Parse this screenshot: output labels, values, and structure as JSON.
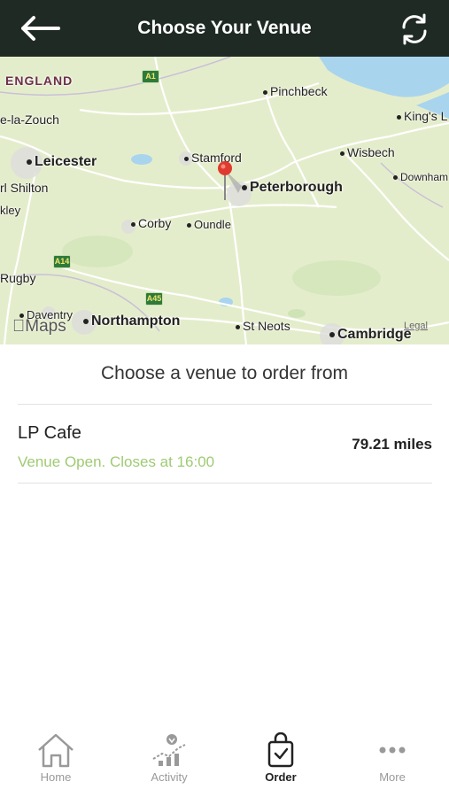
{
  "header": {
    "title": "Choose Your Venue",
    "back_icon": "back-arrow-icon",
    "refresh_icon": "refresh-icon"
  },
  "map": {
    "region_label": "ENGLAND",
    "places": {
      "pinchbeck": "Pinchbeck",
      "kings_lynn": "King's L",
      "ashby": "e-la-Zouch",
      "leicester": "Leicester",
      "stamford": "Stamford",
      "wisbech": "Wisbech",
      "downham": "Downham",
      "hinckley_shilton": "rl Shilton",
      "peterborough": "Peterborough",
      "kley": "kley",
      "corby": "Corby",
      "oundle": "Oundle",
      "rugby": "Rugby",
      "daventry": "Daventry",
      "northampton": "Northampton",
      "st_neots": "St Neots",
      "cambridge": "Cambridge"
    },
    "road_badges": [
      "A1",
      "A14",
      "A45"
    ],
    "provider_label": "Maps",
    "legal_label": "Legal",
    "colors": {
      "land": "#e7eecf",
      "water": "#a9d4ee",
      "road": "#ffffff",
      "pin": "#e03a2f"
    }
  },
  "venues_heading": "Choose a venue to order from",
  "venues": [
    {
      "name": "LP Cafe",
      "status": "Venue Open. Closes at 16:00",
      "distance": "79.21 miles"
    }
  ],
  "tabbar": {
    "home": "Home",
    "activity": "Activity",
    "order": "Order",
    "more": "More",
    "active_tab": "Order"
  }
}
